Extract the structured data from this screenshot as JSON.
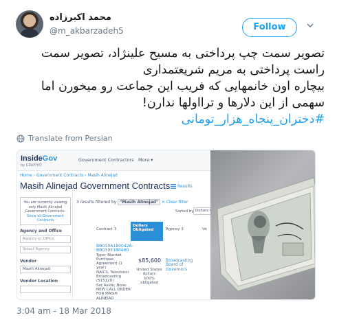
{
  "author": {
    "display_name": "محمد اکبرزاده",
    "handle": "@m_akbarzadeh5"
  },
  "follow_label": "Follow",
  "tweet": {
    "lines": [
      "تصویر سمت چپ پرداختی به مسیح علینژاد، تصویر سمت",
      "راست پرداختی به مریم شریعتمداری",
      "بیچاره اون خانمهایی که فریب این جماعت رو میخورن اما",
      "سهمی از این دلارها و ترااولها ندارن!"
    ],
    "hashtag": "#دختران_پنجاه_هزار_تومانی"
  },
  "translate_label": "Translate from Persian",
  "timestamp": "3:04 am - 18 Mar 2018",
  "screenshot": {
    "logo_inside": "Inside",
    "logo_gov": "Gov",
    "logo_sub": "by GRAPHIQ",
    "nav_contractors": "Government Contractors",
    "nav_more": "More ▾",
    "breadcrumb": "Home › Government Contracts › Masih Alinejad",
    "title": "Masih Alinejad Government Contracts",
    "results_label": "Results",
    "notice_text": "You are currently viewing only Masih Alinejad Government Contracts.",
    "notice_link": "Show all Government Contracts",
    "label_agency_office": "Agency and Office",
    "placeholder_agency_office": "Agency or Office",
    "select_agency": "Select Agency",
    "label_vendor": "Vendor",
    "vendor_value": "Masih Alinejad",
    "label_vendor_location": "Vendor Location",
    "filter_prefix": "3 results filtered by",
    "filter_chip": "\"Masih Alinejad\"",
    "filter_clear": "× Clear filter",
    "sorted_by": "Sorted by",
    "sort_value": "Dollars C",
    "col_contract": "Contract ⇕",
    "col_dollars": "Dollars Obligated",
    "col_agency": "Agency ⇕",
    "col_extra": "Ve",
    "contract_id_1": "BBG50A180042A-",
    "contract_id_2": "BBG50E180460",
    "contract_type": "Type: Blanket Purchase Agreement (1 year)",
    "contract_naics": "NAICS: Television Broadcasting (515120)",
    "contract_set_aside": "Set Aside: None",
    "contract_desc": "NEW CALL ORDER FOR MASIH ALINEJAD",
    "amount": "$85,600",
    "amount_note1": "United States dollars",
    "amount_note2": "100% obligated",
    "agency_value": "Broadcasting Board of Governors"
  }
}
